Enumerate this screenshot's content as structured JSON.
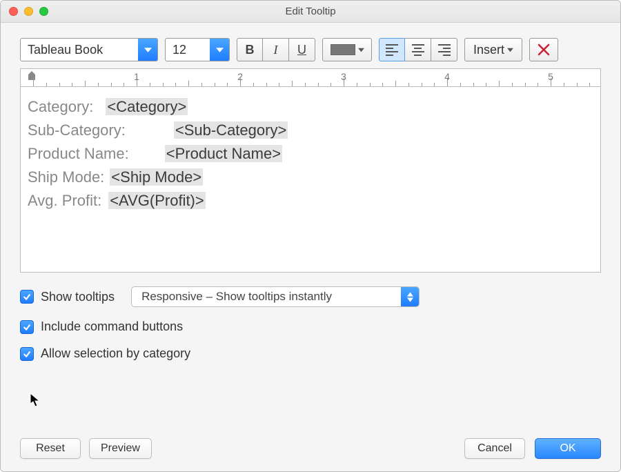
{
  "window": {
    "title": "Edit Tooltip"
  },
  "toolbar": {
    "font_name": "Tableau Book",
    "font_size": "12",
    "bold": "B",
    "italic": "I",
    "underline": "U",
    "insert_label": "Insert"
  },
  "ruler": {
    "labels": [
      "1",
      "2",
      "3",
      "4",
      "5"
    ]
  },
  "editor_lines": [
    {
      "label": "Category:",
      "field": "<Category>"
    },
    {
      "label": "Sub-Category:",
      "field": "<Sub-Category>"
    },
    {
      "label": "Product Name:",
      "field": "<Product Name>"
    },
    {
      "label": "Ship Mode:",
      "field": "<Ship Mode>"
    },
    {
      "label": "Avg. Profit:",
      "field": "<AVG(Profit)>"
    }
  ],
  "options": {
    "show_tooltips_label": "Show tooltips",
    "show_tooltips_checked": true,
    "tooltip_mode": "Responsive – Show tooltips instantly",
    "include_command_label": "Include command buttons",
    "include_command_checked": true,
    "allow_selection_label": "Allow selection by category",
    "allow_selection_checked": true
  },
  "footer": {
    "reset": "Reset",
    "preview": "Preview",
    "cancel": "Cancel",
    "ok": "OK"
  },
  "colors": {
    "accent": "#2a87ff"
  }
}
